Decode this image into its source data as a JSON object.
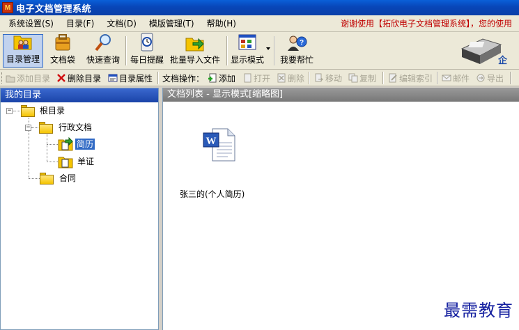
{
  "window": {
    "title": "电子文档管理系统",
    "app_icon_letter": "M"
  },
  "menu": {
    "items": [
      {
        "label": "系统设置(S)"
      },
      {
        "label": "目录(F)"
      },
      {
        "label": "文档(D)"
      },
      {
        "label": "模版管理(T)"
      },
      {
        "label": "帮助(H)"
      }
    ],
    "notice": "谢谢使用【拓欣电子文档管理系统】，您的使用"
  },
  "toolbar": {
    "buttons": [
      {
        "label": "目录管理",
        "icon": "folder-user-icon",
        "active": true
      },
      {
        "label": "文档袋",
        "icon": "document-bag-icon"
      },
      {
        "label": "快速查询",
        "icon": "magnifier-icon"
      },
      {
        "label": "每日提醒",
        "icon": "clock-icon"
      },
      {
        "label": "批量导入文件",
        "icon": "folder-import-icon"
      },
      {
        "label": "显示模式",
        "icon": "display-mode-icon"
      },
      {
        "label": "我要帮忙",
        "icon": "help-person-icon"
      }
    ],
    "brand_text": "企"
  },
  "toolbar2": {
    "add_dir": "添加目录",
    "delete_dir": "删除目录",
    "dir_props": "目录属性",
    "doc_ops_label": "文档操作：",
    "add": "添加",
    "open": "打开",
    "delete": "删除",
    "move": "移动",
    "copy": "复制",
    "edit_index": "编辑索引",
    "mail": "邮件",
    "export": "导出"
  },
  "left_panel": {
    "title": "我的目录",
    "tree": {
      "root": "根目录",
      "admin_docs": "行政文档",
      "resume": "简历",
      "receipt": "单证",
      "contract": "合同"
    }
  },
  "right_panel": {
    "title": "文档列表 - 显示模式[缩略图]",
    "documents": [
      {
        "name": "张三的(个人简历)",
        "type": "word-document-icon"
      }
    ]
  },
  "watermark": "最需教育",
  "colors": {
    "titlebar": "#0846b8",
    "selection": "#316ac5",
    "notice": "#c00000",
    "watermark": "#1520a0"
  }
}
